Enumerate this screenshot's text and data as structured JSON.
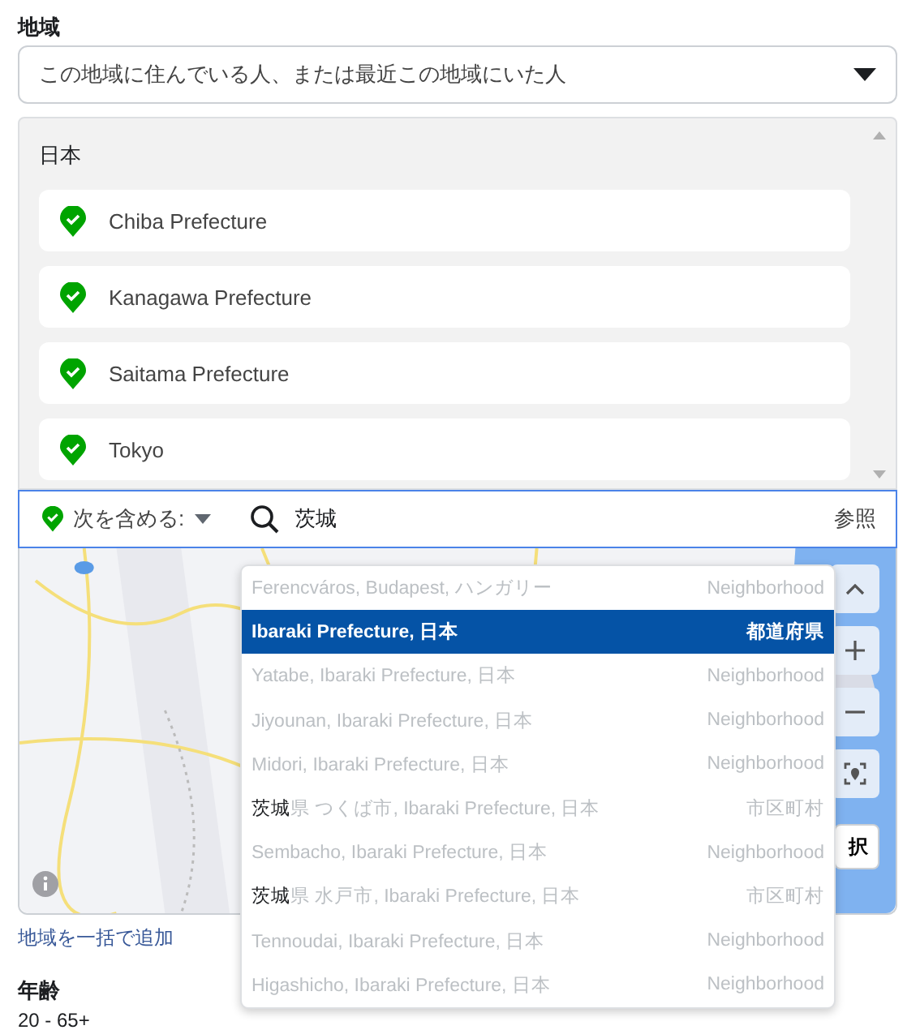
{
  "location": {
    "label": "地域",
    "audience_select": {
      "value": "この地域に住んでいる人、または最近この地域にいた人"
    },
    "selected_locations": {
      "country": "日本",
      "items": [
        {
          "name": "Chiba Prefecture"
        },
        {
          "name": "Kanagawa Prefecture"
        },
        {
          "name": "Saitama Prefecture"
        },
        {
          "name": "Tokyo"
        }
      ]
    },
    "search": {
      "mode": "次を含める:",
      "value": "茨城",
      "browse": "参照"
    },
    "suggestions": [
      {
        "name": "Ferencváros, Budapest, ハンガリー",
        "type": "Neighborhood",
        "selected": false
      },
      {
        "name": "Ibaraki Prefecture, 日本",
        "type": "都道府県",
        "selected": true
      },
      {
        "name": "Yatabe, Ibaraki Prefecture, 日本",
        "type": "Neighborhood",
        "selected": false
      },
      {
        "name": "Jiyounan, Ibaraki Prefecture, 日本",
        "type": "Neighborhood",
        "selected": false
      },
      {
        "name": "Midori, Ibaraki Prefecture, 日本",
        "type": "Neighborhood",
        "selected": false
      },
      {
        "name": "**茨城**県 つくば市, Ibaraki Prefecture, 日本",
        "type": "市区町村",
        "selected": false
      },
      {
        "name": "Sembacho, Ibaraki Prefecture, 日本",
        "type": "Neighborhood",
        "selected": false
      },
      {
        "name": "**茨城**県 水戸市, Ibaraki Prefecture, 日本",
        "type": "市区町村",
        "selected": false
      },
      {
        "name": "Tennoudai, Ibaraki Prefecture, 日本",
        "type": "Neighborhood",
        "selected": false
      },
      {
        "name": "Higashicho, Ibaraki Prefecture, 日本",
        "type": "Neighborhood",
        "selected": false
      }
    ],
    "map": {
      "kind": "picture",
      "select_button": "択"
    },
    "bulk_add_link": "地域を一括で追加"
  },
  "age": {
    "label": "年齢",
    "value": "20 - 65+"
  }
}
